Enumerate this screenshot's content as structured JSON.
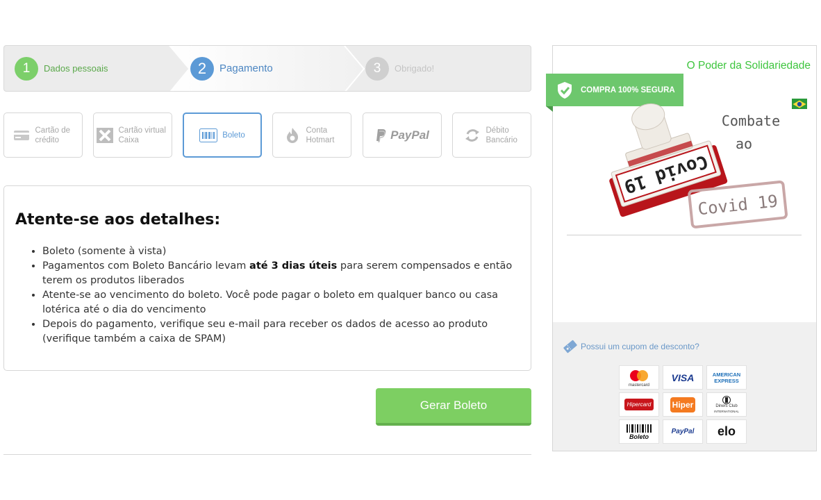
{
  "steps": [
    {
      "number": "1",
      "label": "Dados pessoais"
    },
    {
      "number": "2",
      "label": "Pagamento"
    },
    {
      "number": "3",
      "label": "Obrigado!"
    }
  ],
  "methods": {
    "credit_card": "Cartão de crédito",
    "caixa": "Cartão virtual Caixa",
    "boleto": "Boleto",
    "hotmart": "Conta Hotmart",
    "paypal": "PayPal",
    "debito": "Débito Bancário"
  },
  "details": {
    "title": "Atente-se aos detalhes:",
    "items": [
      {
        "text": "Boleto (somente à vista)"
      },
      {
        "pre": "Pagamentos com Boleto Bancário levam ",
        "bold": "até 3 dias úteis",
        "post": " para serem compensados e então terem os produtos liberados"
      },
      {
        "text": "Atente-se ao vencimento do boleto. Você pode pagar o boleto em qualquer banco ou casa lotérica até o dia do vencimento"
      },
      {
        "text": "Depois do pagamento, verifique seu e-mail para receber os dados de acesso ao produto (verifique também a caixa de SPAM)"
      }
    ]
  },
  "actions": {
    "generate": "Gerar Boleto"
  },
  "sidebar": {
    "title": "O Poder da Solidariedade",
    "secure_badge": "COMPRA 100% SEGURA",
    "banner": {
      "stamp_text": "Covid 19",
      "line1": "Combate",
      "line2": "ao",
      "line3": "Covid 19"
    },
    "coupon": "Possui um cupom de desconto?",
    "cards": {
      "mastercard": "mastercard",
      "visa": "VISA",
      "amex_line1": "AMERICAN",
      "amex_line2": "EXPRESS",
      "hipercard": "Hipercard",
      "hiper": "Hiper",
      "diners_line1": "Diners Club",
      "diners_line2": "INTERNATIONAL",
      "boleto": "Boleto",
      "paypal": "PayPal",
      "elo": "elo"
    }
  },
  "colors": {
    "green": "#7dcf62",
    "blue": "#5c9ad6",
    "sidebar_green": "#3ec53e"
  }
}
